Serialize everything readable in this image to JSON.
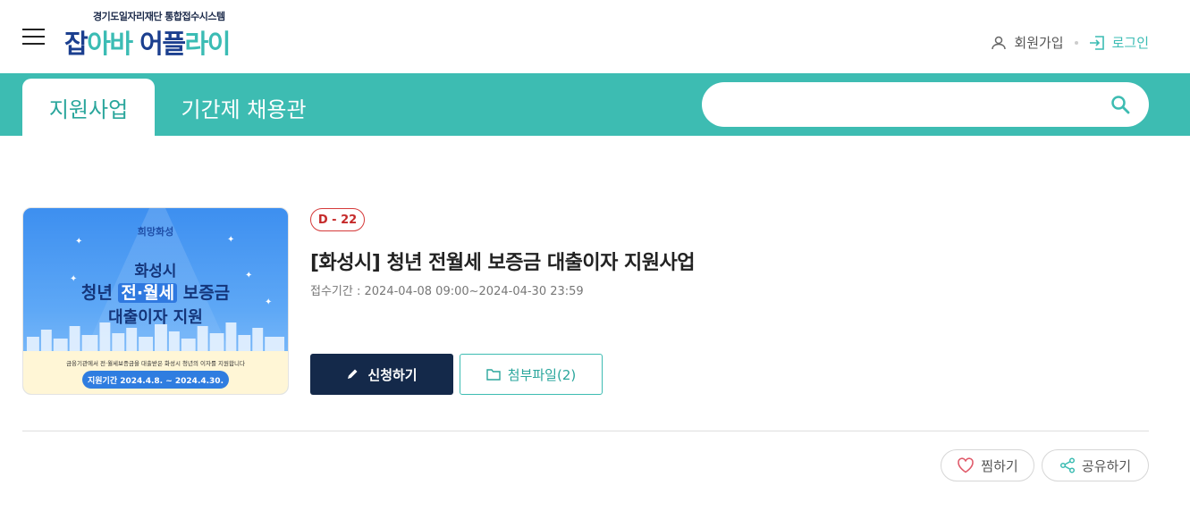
{
  "header": {
    "logo_sub": "경기도일자리재단 통합접수시스템",
    "logo_part1": "잡",
    "logo_part2": "아바 ",
    "logo_part3": "어플",
    "logo_part4": "라이",
    "join_label": "회원가입",
    "login_label": "로그인"
  },
  "nav": {
    "tabs": [
      {
        "label": "지원사업",
        "active": true
      },
      {
        "label": "기간제 채용관",
        "active": false
      }
    ],
    "search": {
      "value": "",
      "placeholder": ""
    }
  },
  "notice": {
    "dday": "D - 22",
    "title": "[화성시] 청년 전월세 보증금 대출이자 지원사업",
    "period_label": "접수기간 :",
    "period_value": "2024-04-08 09:00~2024-04-30 23:59",
    "thumbnail": {
      "logo_text": "희망화성",
      "city": "화성시",
      "line1_a": "청년 ",
      "line1_highlight": "전·월세",
      "line1_b": " 보증금",
      "line2": "대출이자 지원",
      "desc": "금융기관에서 전·월세보증금을 대출받은 화성시 청년의 이자를 지원합니다",
      "period": "지원기간 2024.4.8. ~ 2024.4.30."
    },
    "apply_label": "신청하기",
    "attach_label": "첨부파일(2)"
  },
  "actions": {
    "wish_label": "찜하기",
    "share_label": "공유하기"
  },
  "colors": {
    "brand_teal": "#3dbcb2",
    "navy": "#14294a",
    "dday_red": "#c52a2a"
  }
}
